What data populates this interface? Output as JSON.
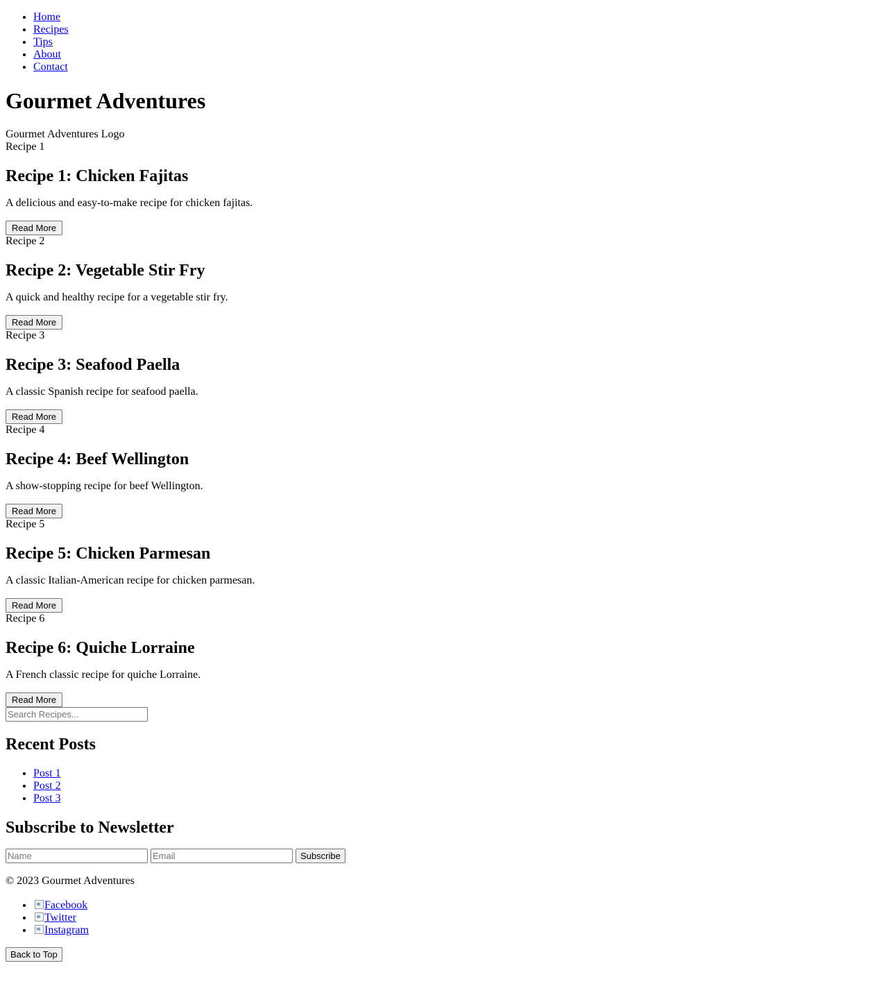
{
  "nav": {
    "items": [
      {
        "label": "Home"
      },
      {
        "label": "Recipes"
      },
      {
        "label": "Tips"
      },
      {
        "label": "About"
      },
      {
        "label": "Contact"
      }
    ]
  },
  "header": {
    "title": "Gourmet Adventures",
    "logo_alt": "Gourmet Adventures Logo"
  },
  "recipes": [
    {
      "image_alt": "Recipe 1",
      "title": "Recipe 1: Chicken Fajitas",
      "description": "A delicious and easy-to-make recipe for chicken fajitas.",
      "button": "Read More"
    },
    {
      "image_alt": "Recipe 2",
      "title": "Recipe 2: Vegetable Stir Fry",
      "description": "A quick and healthy recipe for a vegetable stir fry.",
      "button": "Read More"
    },
    {
      "image_alt": "Recipe 3",
      "title": "Recipe 3: Seafood Paella",
      "description": "A classic Spanish recipe for seafood paella.",
      "button": "Read More"
    },
    {
      "image_alt": "Recipe 4",
      "title": "Recipe 4: Beef Wellington",
      "description": "A show-stopping recipe for beef Wellington.",
      "button": "Read More"
    },
    {
      "image_alt": "Recipe 5",
      "title": "Recipe 5: Chicken Parmesan",
      "description": "A classic Italian-American recipe for chicken parmesan.",
      "button": "Read More"
    },
    {
      "image_alt": "Recipe 6",
      "title": "Recipe 6: Quiche Lorraine",
      "description": "A French classic recipe for quiche Lorraine.",
      "button": "Read More"
    }
  ],
  "search": {
    "placeholder": "Search Recipes..."
  },
  "recent_posts": {
    "heading": "Recent Posts",
    "items": [
      {
        "label": "Post 1"
      },
      {
        "label": "Post 2"
      },
      {
        "label": "Post 3"
      }
    ]
  },
  "newsletter": {
    "heading": "Subscribe to Newsletter",
    "name_placeholder": "Name",
    "email_placeholder": "Email",
    "button": "Subscribe"
  },
  "footer": {
    "copyright": "© 2023 Gourmet Adventures",
    "social": [
      {
        "label": "Facebook",
        "icon": "broken-image-icon"
      },
      {
        "label": "Twitter",
        "icon": "broken-image-icon"
      },
      {
        "label": "Instagram",
        "icon": "broken-image-icon"
      }
    ],
    "back_to_top": "Back to Top"
  },
  "colors": {
    "link": "#0000ee",
    "button_bg": "#efefef",
    "border": "#767676"
  }
}
